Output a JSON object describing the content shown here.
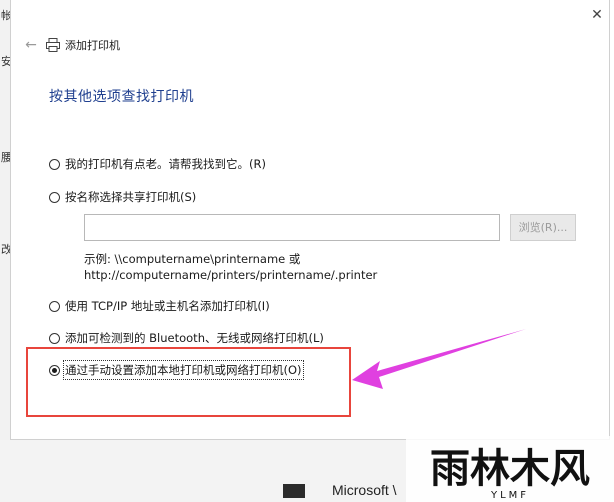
{
  "background": {
    "left_fragments": [
      "帐",
      "安",
      "腰",
      "改"
    ],
    "bottom_window_text": "Microsoft \\"
  },
  "dialog": {
    "close_glyph": "✕",
    "title": "添加打印机",
    "heading": "按其他选项查找打印机",
    "options": [
      {
        "label": "我的打印机有点老。请帮我找到它。(R)",
        "checked": false
      },
      {
        "label": "按名称选择共享打印机(S)",
        "checked": false
      },
      {
        "label": "使用 TCP/IP 地址或主机名添加打印机(I)",
        "checked": false
      },
      {
        "label": "添加可检测到的 Bluetooth、无线或网络打印机(L)",
        "checked": false
      },
      {
        "label": "通过手动设置添加本地打印机或网络打印机(O)",
        "checked": true
      }
    ],
    "share_input_value": "",
    "browse_label": "浏览(R)...",
    "example_line1": "示例: \\\\computername\\printername 或",
    "example_line2": "http://computername/printers/printername/.printer"
  },
  "annotation": {
    "highlight_color": "#e8453c",
    "arrow_color": "#e040e0"
  },
  "watermark": {
    "main_text": "雨林木风",
    "sub_text": "YLMF"
  },
  "colors": {
    "heading": "#1f3f8f",
    "text": "#1a1a1a"
  }
}
